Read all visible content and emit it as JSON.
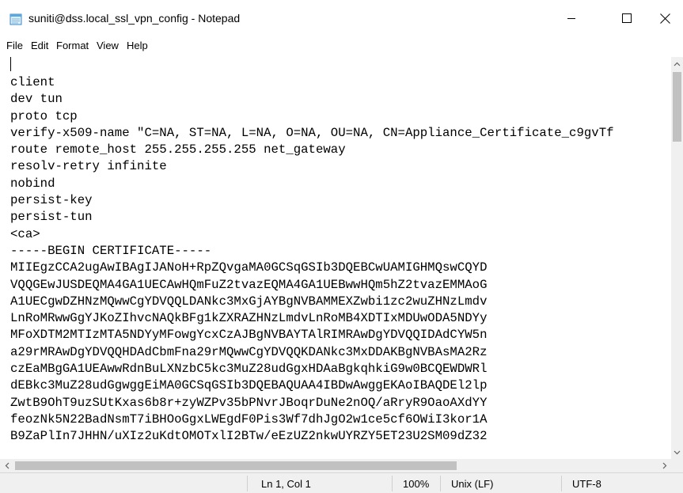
{
  "window": {
    "title": "suniti@dss.local_ssl_vpn_config - Notepad",
    "icon": "notepad-icon"
  },
  "menu": [
    "File",
    "Edit",
    "Format",
    "View",
    "Help"
  ],
  "editor": {
    "lines": [
      "client",
      "dev tun",
      "proto tcp",
      "verify-x509-name \"C=NA, ST=NA, L=NA, O=NA, OU=NA, CN=Appliance_Certificate_c9gvTf",
      "route remote_host 255.255.255.255 net_gateway",
      "resolv-retry infinite",
      "nobind",
      "persist-key",
      "persist-tun",
      "<ca>",
      "-----BEGIN CERTIFICATE-----",
      "MIIEgzCCA2ugAwIBAgIJANoH+RpZQvgaMA0GCSqGSIb3DQEBCwUAMIGHMQswCQYD",
      "VQQGEwJUSDEQMA4GA1UECAwHQmFuZ2tvazEQMA4GA1UEBwwHQm5hZ2tvazEMMAoG",
      "A1UECgwDZHNzMQwwCgYDVQQLDANkc3MxGjAYBgNVBAMMEXZwbi1zc2wuZHNzLmdv",
      "LnRoMRwwGgYJKoZIhvcNAQkBFg1kZXRAZHNzLmdvLnRoMB4XDTIxMDUwODA5NDYy",
      "MFoXDTM2MTIzMTA5NDYyMFowgYcxCzAJBgNVBAYTAlRIMRAwDgYDVQQIDAdCYW5n",
      "a29rMRAwDgYDVQQHDAdCbmFna29rMQwwCgYDVQQKDANkc3MxDDAKBgNVBAsMA2Rz",
      "czEaMBgGA1UEAwwRdnBuLXNzbC5kc3MuZ28udGgxHDAaBgkqhkiG9w0BCQEWDWRl",
      "dEBkc3MuZ28udGgwggEiMA0GCSqGSIb3DQEBAQUAA4IBDwAwggEKAoIBAQDEl2lp",
      "ZwtB9OhT9uzSUtKxas6b8r+zyWZPv35bPNvrJBoqrDuNe2nOQ/aRryR9OaoAXdYY",
      "feozNk5N22BadNsmT7iBHOoGgxLWEgdF0Pis3Wf7dhJgO2w1ce5cf6OWiI3kor1A",
      "B9ZaPlIn7JHHN/uXIz2uKdtOMOTxlI2BTw/eEzUZ2nkwUYRZY5ET23U2SM09dZ32"
    ]
  },
  "status": {
    "position": "Ln 1, Col 1",
    "zoom": "100%",
    "line_ending": "Unix (LF)",
    "encoding": "UTF-8"
  }
}
